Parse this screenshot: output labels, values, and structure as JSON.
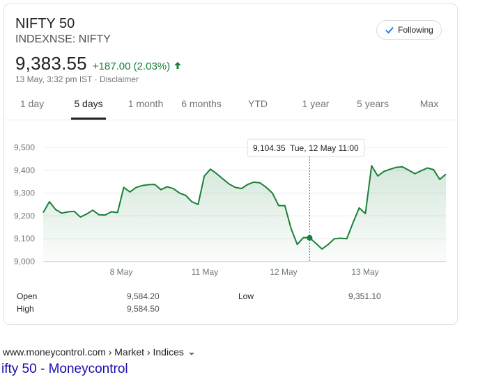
{
  "quote": {
    "name": "NIFTY 50",
    "ticker": "INDEXNSE: NIFTY",
    "price": "9,383.55",
    "change": "+187.00 (2.03%)",
    "timestamp": "13 May, 3:32 pm IST · Disclaimer",
    "follow_label": "Following"
  },
  "tabs": [
    {
      "label": "1 day"
    },
    {
      "label": "5 days"
    },
    {
      "label": "1 month"
    },
    {
      "label": "6 months"
    },
    {
      "label": "YTD"
    },
    {
      "label": "1 year"
    },
    {
      "label": "5 years"
    },
    {
      "label": "Max"
    }
  ],
  "active_tab": "5 days",
  "chart_data": {
    "type": "area",
    "y_ticks": [
      "9,500",
      "9,400",
      "9,300",
      "9,200",
      "9,100",
      "9,000"
    ],
    "ylim": [
      9000,
      9500
    ],
    "x_labels": [
      "8 May",
      "11 May",
      "12 May",
      "13 May"
    ],
    "values": [
      9215,
      9262,
      9228,
      9212,
      9218,
      9220,
      9195,
      9208,
      9225,
      9205,
      9204,
      9218,
      9215,
      9325,
      9305,
      9325,
      9333,
      9337,
      9338,
      9315,
      9328,
      9320,
      9300,
      9290,
      9262,
      9250,
      9375,
      9405,
      9385,
      9362,
      9340,
      9325,
      9320,
      9338,
      9348,
      9345,
      9325,
      9300,
      9245,
      9245,
      9145,
      9075,
      9105,
      9104,
      9080,
      9055,
      9075,
      9100,
      9102,
      9100,
      9170,
      9235,
      9210,
      9420,
      9375,
      9395,
      9405,
      9413,
      9415,
      9400,
      9385,
      9398,
      9410,
      9403,
      9360,
      9383
    ],
    "tooltip": {
      "value": "9,104.35",
      "date": "Tue, 12 May 11:00",
      "index": 43
    },
    "line_color": "#188038",
    "fill_color": "#e6f4ea"
  },
  "stats": {
    "open_label": "Open",
    "open_value": "9,584.20",
    "high_label": "High",
    "high_value": "9,584.50",
    "low_label": "Low",
    "low_value": "9,351.10"
  },
  "source": {
    "url": "www.moneycontrol.com › Market › Indices",
    "title": "ifty 50 - Moneycontrol"
  },
  "colors": {
    "positive": "#188038",
    "link": "#1a0dab"
  }
}
